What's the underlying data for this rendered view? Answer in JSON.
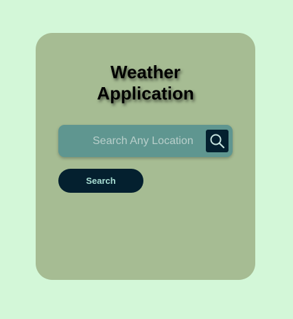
{
  "app": {
    "title": "Weather\nApplication"
  },
  "search": {
    "placeholder": "Search Any Location",
    "value": "",
    "icon": "magnifier-icon",
    "button_label": "Search"
  },
  "colors": {
    "page_background": "#d3f7d8",
    "card_background": "#a6bc93",
    "search_bar": "#5f9690",
    "dark_accent": "#04202f",
    "button_text": "#a9dfd4"
  }
}
